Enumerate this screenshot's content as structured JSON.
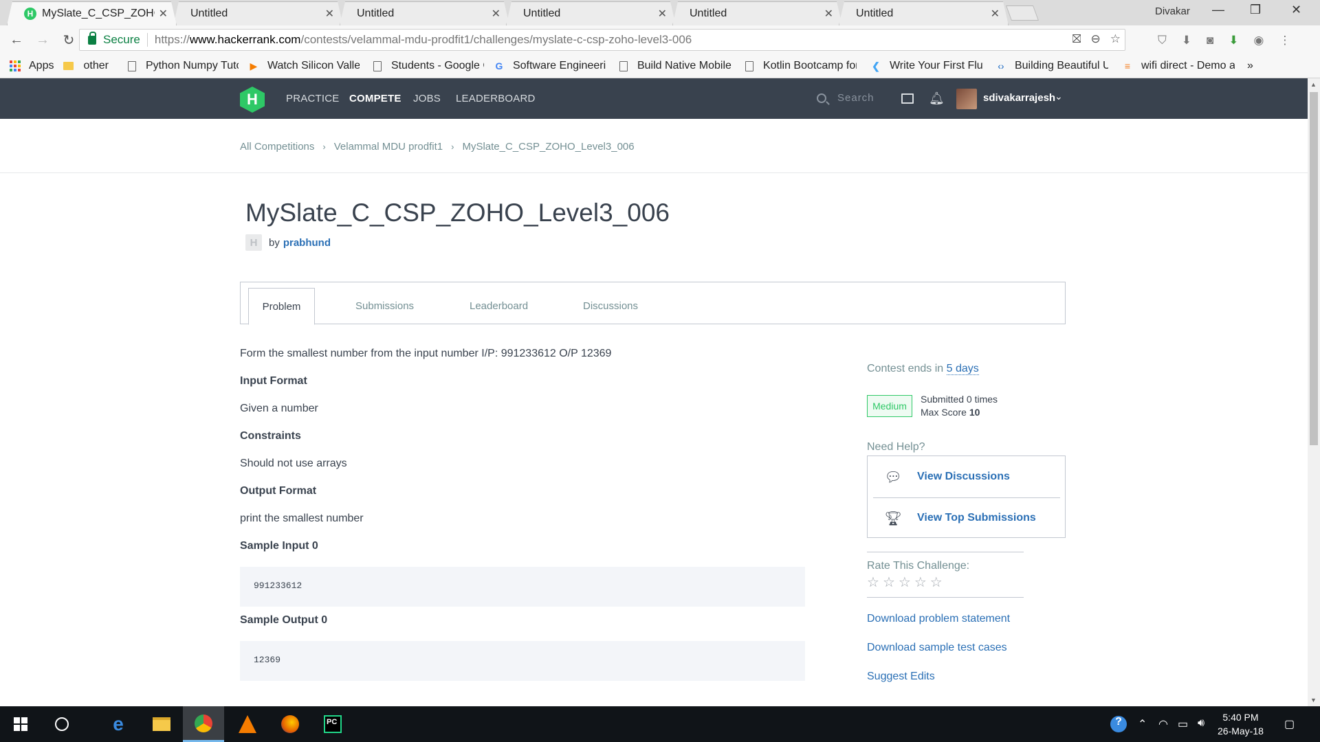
{
  "browser": {
    "tabs": [
      {
        "title": "MySlate_C_CSP_ZOHO_Le",
        "active": true,
        "favicon": "H"
      },
      {
        "title": "Untitled",
        "active": false
      },
      {
        "title": "Untitled",
        "active": false
      },
      {
        "title": "Untitled",
        "active": false
      },
      {
        "title": "Untitled",
        "active": false
      },
      {
        "title": "Untitled",
        "active": false
      }
    ],
    "window_user": "Divakar",
    "window_controls": {
      "minimize": "—",
      "restore": "❒",
      "close": "✕"
    },
    "nav": {
      "back": "←",
      "forward": "→",
      "reload": "↻"
    },
    "secure_label": "Secure",
    "url": {
      "scheme": "https://",
      "host": "www.hackerrank.com",
      "path": "/contests/velammal-mdu-prodfit1/challenges/myslate-c-csp-zoho-level3-006"
    },
    "omnibox_icons": [
      "translate-icon",
      "zoom-icon",
      "star-icon"
    ],
    "extension_icons": [
      "shield-icon",
      "download-icon",
      "camera-icon",
      "idm-icon",
      "extension-icon",
      "menu-icon"
    ],
    "bookmarks": [
      {
        "label": "Apps",
        "icon": "apps-grid-icon"
      },
      {
        "label": "other",
        "icon": "folder-icon"
      },
      {
        "label": "Python Numpy Tuto",
        "icon": "page-icon"
      },
      {
        "label": "Watch Silicon Valley",
        "icon": "play-icon"
      },
      {
        "label": "Students - Google C",
        "icon": "page-icon"
      },
      {
        "label": "Software Engineerin",
        "icon": "google-icon"
      },
      {
        "label": "Build Native Mobile",
        "icon": "page-icon"
      },
      {
        "label": "Kotlin Bootcamp for",
        "icon": "page-icon"
      },
      {
        "label": "Write Your First Flutt",
        "icon": "flutter-icon"
      },
      {
        "label": "Building Beautiful UI",
        "icon": "code-icon"
      },
      {
        "label": "wifi direct - Demo ap",
        "icon": "stackoverflow-icon"
      }
    ],
    "bookmarks_overflow": "»"
  },
  "hr_nav": {
    "logo": "H",
    "links": [
      "PRACTICE",
      "COMPETE",
      "JOBS",
      "LEADERBOARD"
    ],
    "active_link": "COMPETE",
    "search_placeholder": "Search",
    "username": "sdivakarrajesh",
    "caret": "⌄"
  },
  "breadcrumb": {
    "items": [
      "All Competitions",
      "Velammal MDU prodfit1",
      "MySlate_C_CSP_ZOHO_Level3_006"
    ],
    "separator": "›"
  },
  "challenge": {
    "title": "MySlate_C_CSP_ZOHO_Level3_006",
    "author_icon": "H",
    "by_label": "by",
    "author": "prabhund"
  },
  "tabs": [
    "Problem",
    "Submissions",
    "Leaderboard",
    "Discussions"
  ],
  "problem": {
    "statement": "Form the smallest number from the input number I/P: 991233612 O/P 12369",
    "input_format_heading": "Input Format",
    "input_format": "Given a number",
    "constraints_heading": "Constraints",
    "constraints": "Should not use arrays",
    "output_format_heading": "Output Format",
    "output_format": "print the smallest number",
    "sample_input_heading": "Sample Input 0",
    "sample_input": "991233612",
    "sample_output_heading": "Sample Output 0",
    "sample_output": "12369"
  },
  "sidebar": {
    "contest_ends_prefix": "Contest ends in",
    "contest_ends_value": "5 days",
    "difficulty": "Medium",
    "submitted": "Submitted 0 times",
    "max_score_label": "Max Score",
    "max_score_value": "10",
    "need_help": "Need Help?",
    "view_discussions": "View Discussions",
    "view_top_submissions": "View Top Submissions",
    "rate_label": "Rate This Challenge:",
    "stars": [
      "☆",
      "☆",
      "☆",
      "☆",
      "☆"
    ],
    "download_statement": "Download problem statement",
    "download_tests": "Download sample test cases",
    "suggest_edits": "Suggest Edits"
  },
  "taskbar": {
    "time": "5:40 PM",
    "date": "26-May-18",
    "apps": [
      "edge-icon",
      "file-explorer-icon",
      "chrome-icon",
      "vlc-icon",
      "firefox-icon",
      "pycharm-icon"
    ]
  }
}
